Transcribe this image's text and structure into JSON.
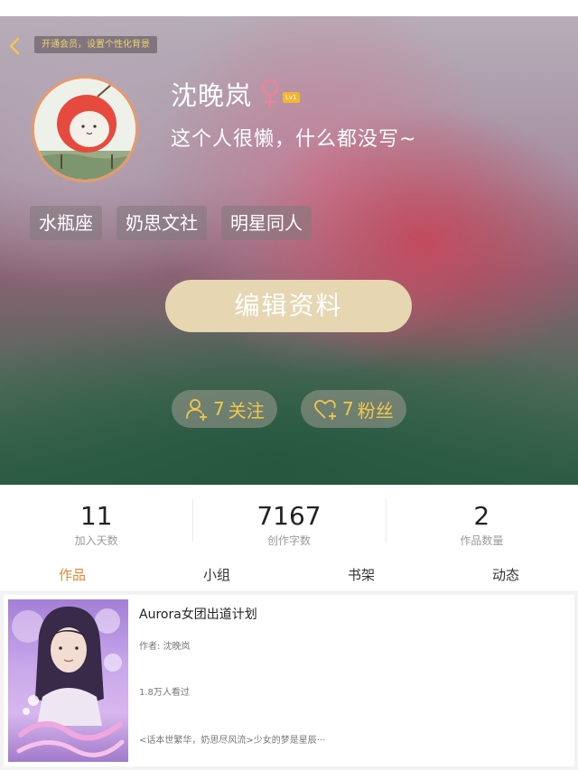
{
  "header": {
    "vip_banner": "开通会员，设置个性化背景",
    "back_icon": "chevron-left-icon"
  },
  "profile": {
    "username": "沈晚岚",
    "gender_icon": "female-icon",
    "level": "Lv1",
    "signature": "这个人很懒，什么都没写~",
    "tags": [
      "水瓶座",
      "奶思文社",
      "明星同人"
    ],
    "edit_label": "编辑资料",
    "following": {
      "count": "7",
      "label": "关注",
      "icon": "add-user-icon"
    },
    "fans": {
      "count": "7",
      "label": "粉丝",
      "icon": "heart-plus-icon"
    }
  },
  "stats": [
    {
      "value": "11",
      "label": "加入天数"
    },
    {
      "value": "7167",
      "label": "创作字数"
    },
    {
      "value": "2",
      "label": "作品数量"
    }
  ],
  "tabs": [
    {
      "label": "作品",
      "active": true
    },
    {
      "label": "小组",
      "active": false
    },
    {
      "label": "书架",
      "active": false
    },
    {
      "label": "动态",
      "active": false
    }
  ],
  "works": [
    {
      "title": "Aurora女团出道计划",
      "author": "作者: 沈晚岚",
      "views": "1.8万人看过",
      "description": "<话本世繁华，奶思尽风流>少女的梦是星辰···"
    }
  ],
  "colors": {
    "accent": "#f0832f",
    "pill_text": "#f2c74e",
    "edit_button": "#e6d7b2",
    "avatar_border": "#e79a6d",
    "level_badge": "#f2b632"
  }
}
